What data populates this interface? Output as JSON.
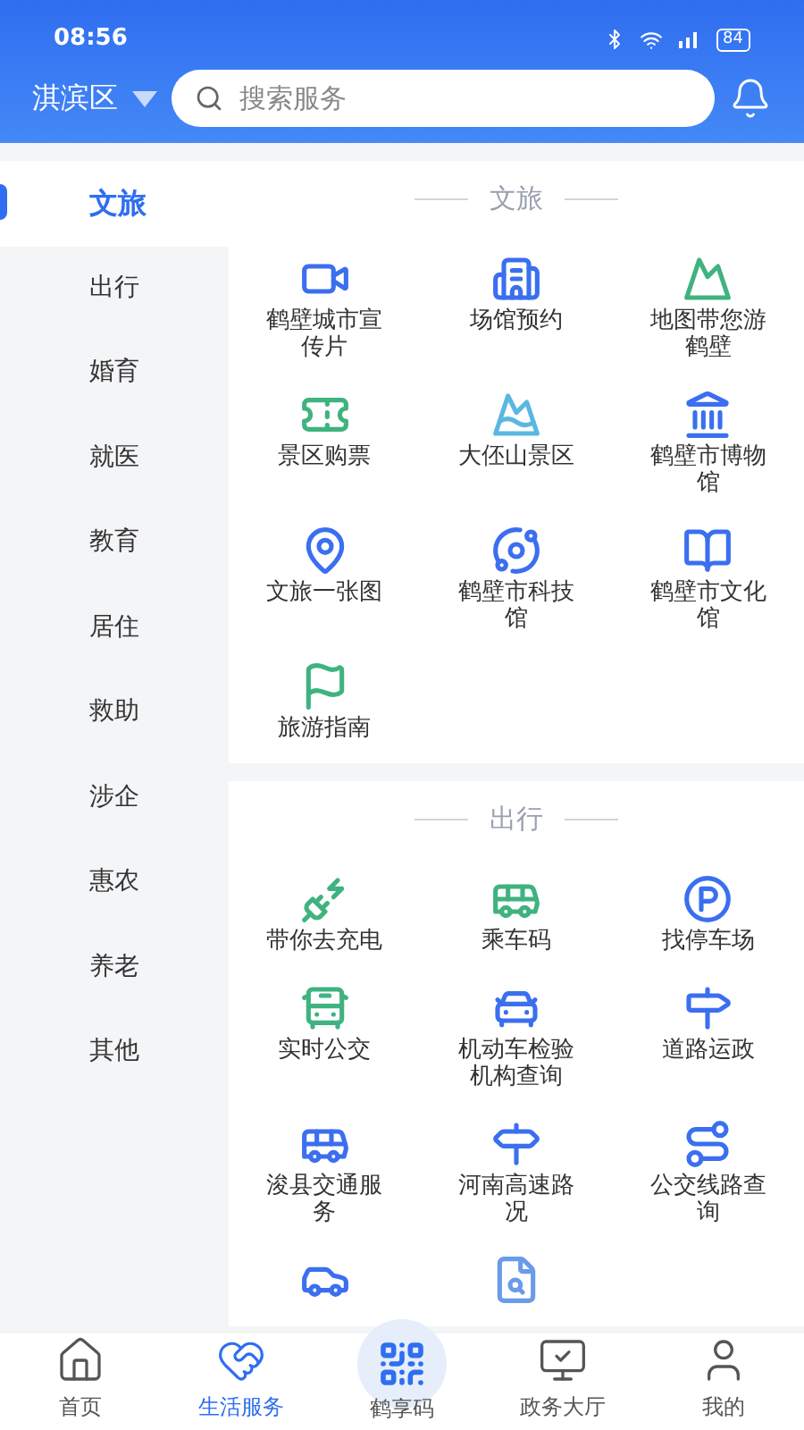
{
  "status_bar": {
    "time": "08:56",
    "battery": "84"
  },
  "header": {
    "district": "淇滨区",
    "search": {
      "placeholder": "搜索服务"
    }
  },
  "sidebar": {
    "items": [
      {
        "label": "文旅",
        "selected": true
      },
      {
        "label": "出行",
        "selected": false
      },
      {
        "label": "婚育",
        "selected": false
      },
      {
        "label": "就医",
        "selected": false
      },
      {
        "label": "教育",
        "selected": false
      },
      {
        "label": "居住",
        "selected": false
      },
      {
        "label": "救助",
        "selected": false
      },
      {
        "label": "涉企",
        "selected": false
      },
      {
        "label": "惠农",
        "selected": false
      },
      {
        "label": "养老",
        "selected": false
      },
      {
        "label": "其他",
        "selected": false
      }
    ]
  },
  "sections": [
    {
      "title": "文旅",
      "items": [
        {
          "kind": "service",
          "label": "鹤壁城市宣传片"
        },
        {
          "kind": "service",
          "label": "场馆预约"
        },
        {
          "kind": "service",
          "label": "地图带您游鹤壁"
        },
        {
          "kind": "service",
          "label": "景区购票"
        },
        {
          "kind": "service",
          "label": "大伾山景区"
        },
        {
          "kind": "service",
          "label": "鹤壁市博物馆"
        },
        {
          "kind": "service",
          "label": "文旅一张图"
        },
        {
          "kind": "service",
          "label": "鹤壁市科技馆"
        },
        {
          "kind": "service",
          "label": "鹤壁市文化馆"
        },
        {
          "kind": "service",
          "label": "旅游指南"
        }
      ]
    },
    {
      "title": "出行",
      "items": [
        {
          "kind": "service",
          "label": "带你去充电"
        },
        {
          "kind": "service",
          "label": "乘车码"
        },
        {
          "kind": "service",
          "label": "找停车场"
        },
        {
          "kind": "service",
          "label": "实时公交"
        },
        {
          "kind": "service",
          "label": "机动车检验机构查询"
        },
        {
          "kind": "service",
          "label": "道路运政"
        },
        {
          "kind": "service",
          "label": "浚县交通服务"
        },
        {
          "kind": "service",
          "label": "河南高速路况"
        },
        {
          "kind": "service",
          "label": "公交线路查询"
        },
        {
          "kind": "icon_only"
        },
        {
          "kind": "icon_only"
        }
      ]
    }
  ],
  "tab_bar": {
    "tabs": [
      {
        "label": "首页",
        "selected": false
      },
      {
        "label": "生活服务",
        "selected": true
      },
      {
        "label": "鹤享码",
        "selected": false,
        "kind": "raised"
      },
      {
        "label": "政务大厅",
        "selected": false
      },
      {
        "label": "我的",
        "selected": false
      }
    ]
  }
}
